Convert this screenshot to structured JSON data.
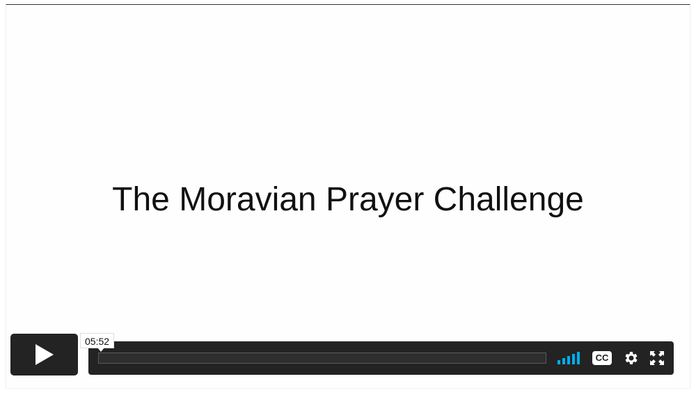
{
  "video": {
    "title": "The Moravian Prayer Challenge"
  },
  "controls": {
    "play_icon": "play-icon",
    "time_tooltip": "05:52",
    "progress": 0,
    "volume_icon": "volume-bars-icon",
    "cc_label": "CC",
    "settings_icon": "gear-icon",
    "fullscreen_icon": "fullscreen-icon"
  },
  "colors": {
    "accent": "#00adef",
    "control_bg": "#232323"
  }
}
